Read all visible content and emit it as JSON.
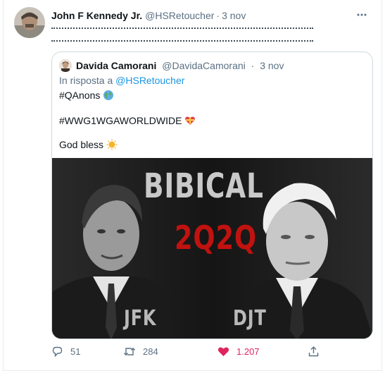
{
  "tweet": {
    "author_name": "John F Kennedy Jr.",
    "author_handle": "@HSRetoucher",
    "separator": "·",
    "time": "3 nov",
    "more_icon": "more-horizontal-icon"
  },
  "quoted_tweet": {
    "author_name": "Davida Camorani",
    "author_handle": "@DavidaCamorani",
    "separator": "·",
    "time": "3 nov",
    "reply_prefix": "In risposta a",
    "reply_to": "@HSRetoucher",
    "lines": [
      "#QAnons",
      "#WWG1WGAWORLDWIDE",
      "God bless"
    ],
    "emojis": [
      "globe-icon",
      "heart-ribbon-icon",
      "sun-icon"
    ],
    "image": {
      "title": "BIBICAL",
      "year": "2Q2Q",
      "left_label": "JFK",
      "right_label": "DJT"
    }
  },
  "actions": {
    "reply_count": "51",
    "retweet_count": "284",
    "like_count": "1.207",
    "like_color": "#e0245e",
    "accent_color": "#1b95e0"
  }
}
